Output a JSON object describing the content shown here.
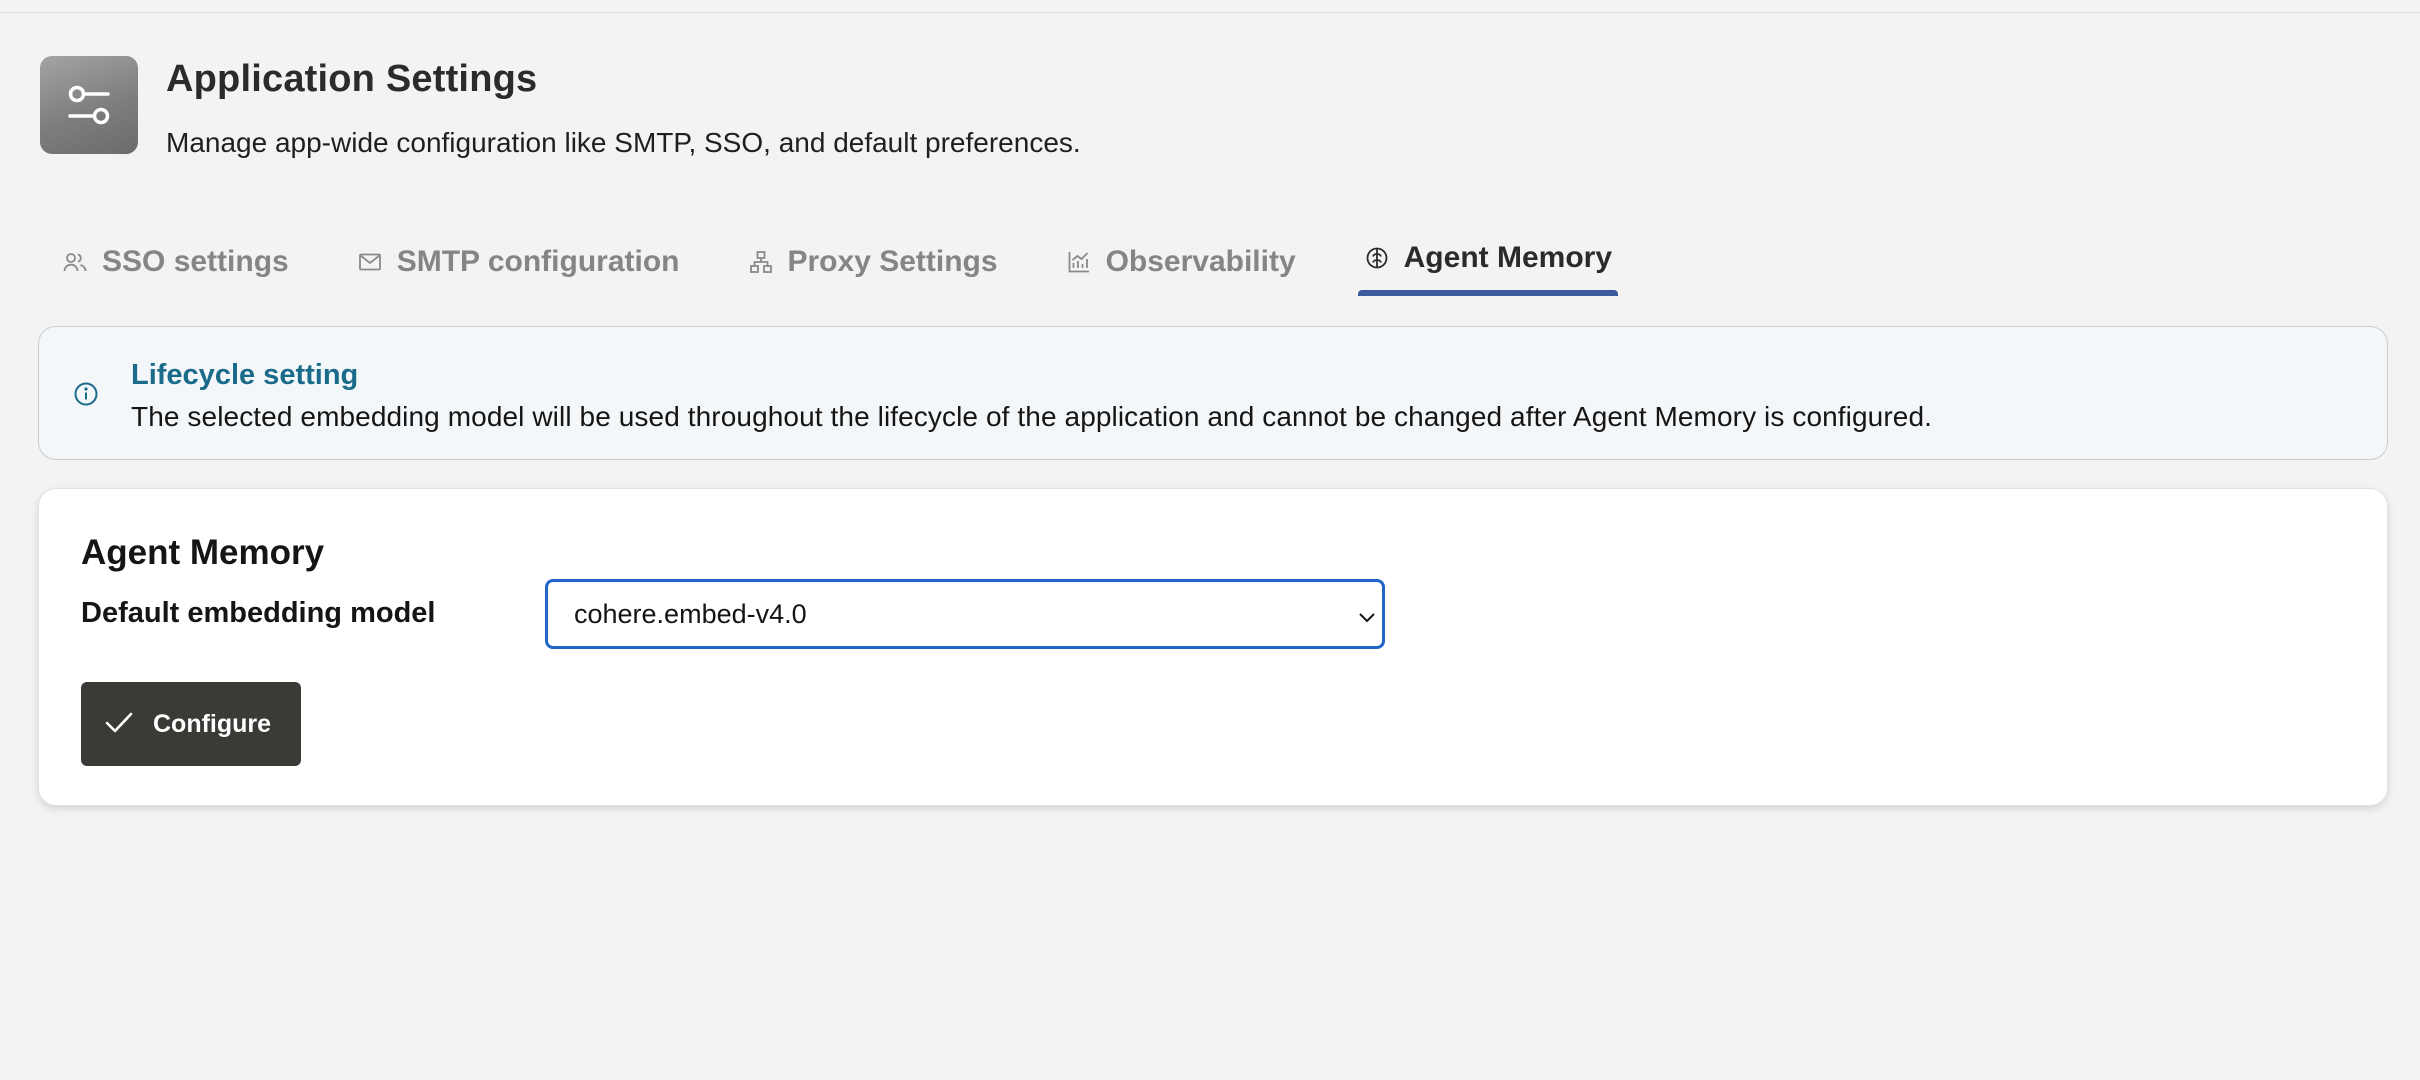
{
  "header": {
    "title": "Application Settings",
    "subtitle": "Manage app-wide configuration like SMTP, SSO, and default preferences.",
    "icon": "settings-sliders-icon"
  },
  "tabs": [
    {
      "label": "SSO settings",
      "icon": "users-icon",
      "active": false
    },
    {
      "label": "SMTP configuration",
      "icon": "mail-icon",
      "active": false
    },
    {
      "label": "Proxy Settings",
      "icon": "network-icon",
      "active": false
    },
    {
      "label": "Observability",
      "icon": "chart-icon",
      "active": false
    },
    {
      "label": "Agent Memory",
      "icon": "brain-icon",
      "active": true
    }
  ],
  "banner": {
    "title": "Lifecycle setting",
    "text": "The selected embedding model will be used throughout the lifecycle of the application and cannot be changed after Agent Memory is configured.",
    "icon": "info-icon"
  },
  "card": {
    "title": "Agent Memory",
    "field_label": "Default embedding model",
    "select_value": "cohere.embed-v4.0",
    "button_label": "Configure"
  },
  "colors": {
    "accent": "#3d5b9c",
    "info_title": "#1a6a8a",
    "select_border": "#2166c8",
    "button_bg": "#3c3a37"
  }
}
